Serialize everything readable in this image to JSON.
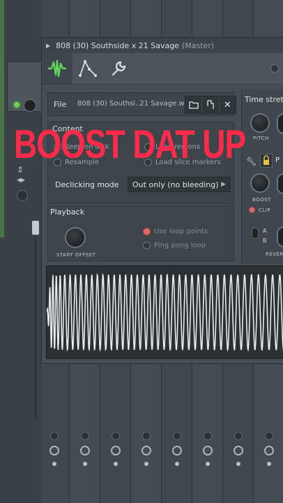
{
  "window": {
    "title": "808 (30) Southside x 21 Savage",
    "title_suffix": "(Master)"
  },
  "toolbar": {
    "tabs": [
      "waveform-icon",
      "envelope-icon",
      "wrench-icon"
    ]
  },
  "file": {
    "label": "File",
    "name": "808 (30) Southsi..21 Savage.wav"
  },
  "content": {
    "title": "Content",
    "options": [
      {
        "label": "Keep on disk"
      },
      {
        "label": "Load regions"
      },
      {
        "label": "Resample"
      },
      {
        "label": "Load slice markers"
      }
    ],
    "declicking_label": "Declicking mode",
    "declicking_value": "Out only (no bleeding)"
  },
  "playback": {
    "title": "Playback",
    "start_offset_label": "START OFFSET",
    "use_loop_points": "Use loop points",
    "ping_pong_loop": "Ping pong loop"
  },
  "right_panel": {
    "time_stretch": "Time stretc",
    "pitch_label": "PITCH",
    "boost_label": "BOOST",
    "clip_label": "CLIP",
    "a_label": "A",
    "b_label": "B",
    "reverse_label": "REVERS",
    "p_label": "P"
  },
  "overlay": {
    "text": "BOOST DAT UP"
  },
  "colors": {
    "accent_green": "#5fd35a",
    "overlay_red": "#ff2a4a",
    "led_red": "#e06a6a"
  }
}
